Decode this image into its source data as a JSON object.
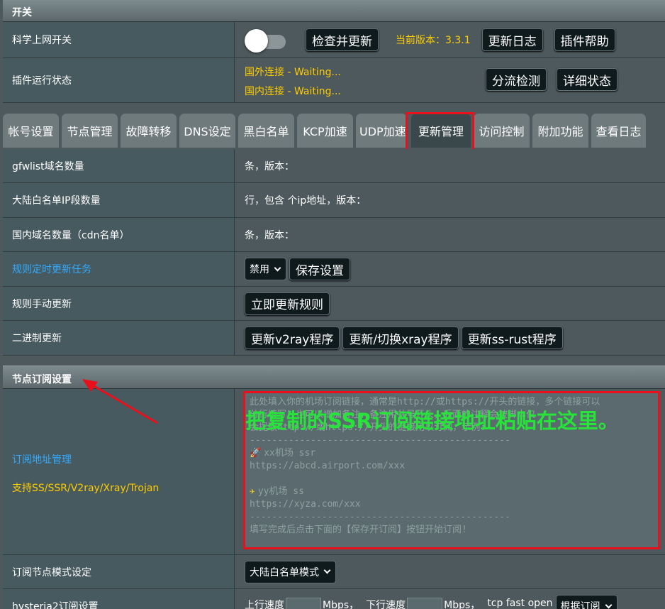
{
  "top_section": {
    "title": "开关"
  },
  "switch_row": {
    "label": "科学上网开关",
    "check_update": "检查并更新",
    "version_text": "当前版本：3.3.1",
    "changelog": "更新日志",
    "plugin_help": "插件帮助"
  },
  "status_row": {
    "label": "插件运行状态",
    "foreign": "国外连接 - Waiting...",
    "domestic": "国内连接 - Waiting...",
    "split_check": "分流检测",
    "detail_status": "详细状态"
  },
  "tabs": [
    {
      "label": "帐号设置"
    },
    {
      "label": "节点管理"
    },
    {
      "label": "故障转移"
    },
    {
      "label": "DNS设定"
    },
    {
      "label": "黑白名单"
    },
    {
      "label": "KCP加速"
    },
    {
      "label": "UDP加速"
    },
    {
      "label": "更新管理"
    },
    {
      "label": "访问控制"
    },
    {
      "label": "附加功能"
    },
    {
      "label": "查看日志"
    }
  ],
  "update_rows": {
    "gfwlist": {
      "label": "gfwlist域名数量",
      "value": "条，版本："
    },
    "chnroute": {
      "label": "大陆白名单IP段数量",
      "value": "行，包含  个ip地址，版本："
    },
    "cdn": {
      "label": "国内域名数量（cdn名单）",
      "value": "条，版本："
    },
    "schedule": {
      "label": "规则定时更新任务",
      "select": "禁用",
      "save": "保存设置"
    },
    "manual": {
      "label": "规则手动更新",
      "button": "立即更新规则"
    },
    "binary": {
      "label": "二进制更新",
      "v2ray": "更新v2ray程序",
      "xray": "更新/切换xray程序",
      "ssrust": "更新ss-rust程序"
    }
  },
  "sub_section": {
    "title": "节点订阅设置",
    "manage_label": "订阅地址管理",
    "support_label": "支持SS/SSR/V2ray/Xray/Trojan",
    "textarea_lines": [
      "此处填入你的机场订阅链接，通常是http://或https://开头的链接，多个链接可以",
      "分行填写！也可以增加备注，备注用井号开头，后面的注释会被脚本仅",
      "会提取http://或https://开头的链接用以订阅，示例:",
      "-----------------------------------------------",
      "xx机场 ssr",
      "https://abcd.airport.com/xxx",
      "",
      "yy机场 ss",
      "https://xyza.com/xxx",
      "-----------------------------------------------",
      "填写完成后点击下面的【保存开订阅】按钮开始订阅!"
    ],
    "overlay_note": "把复制的SSR订阅链接地址粘贴在这里。",
    "mode_label": "订阅节点模式设定",
    "mode_select": "大陆白名单模式",
    "hy_label": "hysteria2订阅设置",
    "hy_up": "上行速度",
    "hy_mbps1": "Mbps，",
    "hy_down": "下行速度",
    "hy_mbps2": "Mbps，",
    "hy_tfo": "tcp fast open",
    "hy_select": "根据订阅"
  },
  "colors": {
    "accent_yellow": "#ffcc00",
    "accent_blue": "#33aaff",
    "highlight_red": "#e8101a",
    "overlay_green": "#27e33a"
  },
  "icons": {
    "rocket": "rocket-icon",
    "plane": "airplane-icon"
  }
}
